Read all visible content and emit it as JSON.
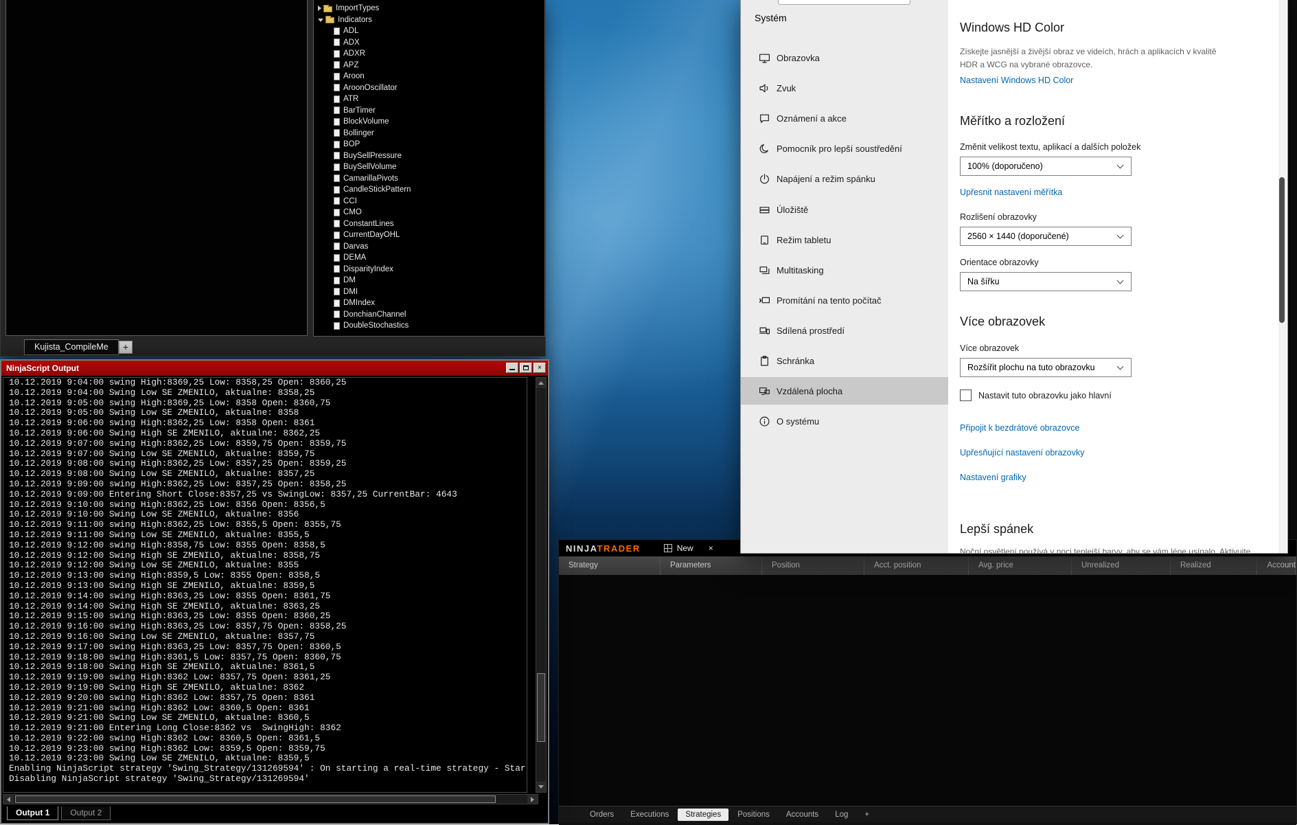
{
  "editor": {
    "tree": {
      "folders": [
        "ImportTypes",
        "Indicators"
      ],
      "indicators": [
        "ADL",
        "ADX",
        "ADXR",
        "APZ",
        "Aroon",
        "AroonOscillator",
        "ATR",
        "BarTimer",
        "BlockVolume",
        "Bollinger",
        "BOP",
        "BuySellPressure",
        "BuySellVolume",
        "CamarillaPivots",
        "CandleStickPattern",
        "CCI",
        "CMO",
        "ConstantLines",
        "CurrentDayOHL",
        "Darvas",
        "DEMA",
        "DisparityIndex",
        "DM",
        "DMI",
        "DMIndex",
        "DonchianChannel",
        "DoubleStochastics"
      ]
    },
    "tab": "Kujista_CompileMe",
    "new_tab_button": "+"
  },
  "output_window": {
    "title": "NinjaScript Output",
    "close_glyph": "×",
    "log_lines": [
      "10.12.2019 9:04:00 swing High:8369,25 Low: 8358,25 Open: 8360,25",
      "10.12.2019 9:04:00 Swing Low SE ZMENILO, aktualne: 8358,25",
      "10.12.2019 9:05:00 swing High:8369,25 Low: 8358 Open: 8360,75",
      "10.12.2019 9:05:00 Swing Low SE ZMENILO, aktualne: 8358",
      "10.12.2019 9:06:00 swing High:8362,25 Low: 8358 Open: 8361",
      "10.12.2019 9:06:00 Swing High SE ZMENILO, aktualne: 8362,25",
      "10.12.2019 9:07:00 swing High:8362,25 Low: 8359,75 Open: 8359,75",
      "10.12.2019 9:07:00 Swing Low SE ZMENILO, aktualne: 8359,75",
      "10.12.2019 9:08:00 swing High:8362,25 Low: 8357,25 Open: 8359,25",
      "10.12.2019 9:08:00 Swing Low SE ZMENILO, aktualne: 8357,25",
      "10.12.2019 9:09:00 swing High:8362,25 Low: 8357,25 Open: 8358,25",
      "10.12.2019 9:09:00 Entering Short Close:8357,25 vs SwingLow: 8357,25 CurrentBar: 4643",
      "10.12.2019 9:10:00 swing High:8362,25 Low: 8356 Open: 8356,5",
      "10.12.2019 9:10:00 Swing Low SE ZMENILO, aktualne: 8356",
      "10.12.2019 9:11:00 swing High:8362,25 Low: 8355,5 Open: 8355,75",
      "10.12.2019 9:11:00 Swing Low SE ZMENILO, aktualne: 8355,5",
      "10.12.2019 9:12:00 swing High:8358,75 Low: 8355 Open: 8358,5",
      "10.12.2019 9:12:00 Swing High SE ZMENILO, aktualne: 8358,75",
      "10.12.2019 9:12:00 Swing Low SE ZMENILO, aktualne: 8355",
      "10.12.2019 9:13:00 swing High:8359,5 Low: 8355 Open: 8358,5",
      "10.12.2019 9:13:00 Swing High SE ZMENILO, aktualne: 8359,5",
      "10.12.2019 9:14:00 swing High:8363,25 Low: 8355 Open: 8361,75",
      "10.12.2019 9:14:00 Swing High SE ZMENILO, aktualne: 8363,25",
      "10.12.2019 9:15:00 swing High:8363,25 Low: 8355 Open: 8360,25",
      "10.12.2019 9:16:00 swing High:8363,25 Low: 8357,75 Open: 8358,25",
      "10.12.2019 9:16:00 Swing Low SE ZMENILO, aktualne: 8357,75",
      "10.12.2019 9:17:00 swing High:8363,25 Low: 8357,75 Open: 8360,5",
      "10.12.2019 9:18:00 swing High:8361,5 Low: 8357,75 Open: 8360,75",
      "10.12.2019 9:18:00 Swing High SE ZMENILO, aktualne: 8361,5",
      "10.12.2019 9:19:00 swing High:8362 Low: 8357,75 Open: 8361,25",
      "10.12.2019 9:19:00 Swing High SE ZMENILO, aktualne: 8362",
      "10.12.2019 9:20:00 swing High:8362 Low: 8357,75 Open: 8361",
      "10.12.2019 9:21:00 swing High:8362 Low: 8360,5 Open: 8361",
      "10.12.2019 9:21:00 Swing Low SE ZMENILO, aktualne: 8360,5",
      "10.12.2019 9:21:00 Entering Long Close:8362 vs  SwingHigh: 8362",
      "10.12.2019 9:22:00 swing High:8362 Low: 8360,5 Open: 8361,5",
      "10.12.2019 9:23:00 swing High:8362 Low: 8359,5 Open: 8359,75",
      "10.12.2019 9:23:00 Swing Low SE ZMENILO, aktualne: 8359,5",
      "Enabling NinjaScript strategy 'Swing_Strategy/131269594' : On starting a real-time strategy - Star",
      "Disabling NinjaScript strategy 'Swing_Strategy/131269594'"
    ],
    "tabs": [
      {
        "label": "Output 1",
        "active": true
      },
      {
        "label": "Output 2"
      }
    ]
  },
  "settings": {
    "sidebar": {
      "title": "Systém",
      "items": [
        {
          "label": "Obrazovka"
        },
        {
          "label": "Zvuk"
        },
        {
          "label": "Oznámení a akce"
        },
        {
          "label": "Pomocník pro lepší soustředění"
        },
        {
          "label": "Napájení a režim spánku"
        },
        {
          "label": "Úložiště"
        },
        {
          "label": "Režim tabletu"
        },
        {
          "label": "Multitasking"
        },
        {
          "label": "Promítání na tento počítač"
        },
        {
          "label": "Sdílená prostředí"
        },
        {
          "label": "Schránka"
        },
        {
          "label": "Vzdálená plocha",
          "active": true
        },
        {
          "label": "O systému"
        }
      ]
    },
    "content": {
      "hd_color_title": "Windows HD Color",
      "hd_color_desc_1": "Získejte jasnější a živější obraz ve videích, hrách a aplikacích v kvalitě",
      "hd_color_desc_2": "HDR a WCG na vybrané obrazovce.",
      "hd_color_link": "Nastavení Windows HD Color",
      "scale_title": "Měřítko a rozložení",
      "scale_label": "Změnit velikost textu, aplikací a dalších položek",
      "scale_value": "100% (doporučeno)",
      "scale_link": "Upřesnit nastavení měřítka",
      "resolution_label": "Rozlišení obrazovky",
      "resolution_value": "2560 × 1440 (doporučené)",
      "orientation_label": "Orientace obrazovky",
      "orientation_value": "Na šířku",
      "multi_title": "Více obrazovek",
      "multi_label": "Více obrazovek",
      "multi_value": "Rozšířit plochu na tuto obrazovku",
      "primary_checkbox_label": "Nastavit tuto obrazovku jako hlavní",
      "link_wireless": "Připojit k bezdrátové obrazovce",
      "link_advanced": "Upřesňující nastavení obrazovky",
      "link_graphics": "Nastavení grafiky",
      "sleep_title": "Lepší spánek",
      "sleep_desc": "Noční osvětlení používá v noci teplejší barvy, aby se vám lépe usínalo. Aktivujte"
    },
    "accent_color": "#0066b4"
  },
  "ninjatrader": {
    "logo_ninja": "NINJA",
    "logo_trader": "TRADER",
    "logo_trader_color": "#ff6600",
    "menu_new": "New",
    "x_glyph": "×",
    "columns": [
      "Strategy",
      "Parameters",
      "Position",
      "Acct. position",
      "Avg. price",
      "Unrealized",
      "Realized",
      "Account"
    ],
    "tabs": [
      {
        "label": "Orders"
      },
      {
        "label": "Executions"
      },
      {
        "label": "Strategies",
        "active": true
      },
      {
        "label": "Positions"
      },
      {
        "label": "Accounts"
      },
      {
        "label": "Log"
      },
      {
        "label": "+"
      }
    ]
  }
}
